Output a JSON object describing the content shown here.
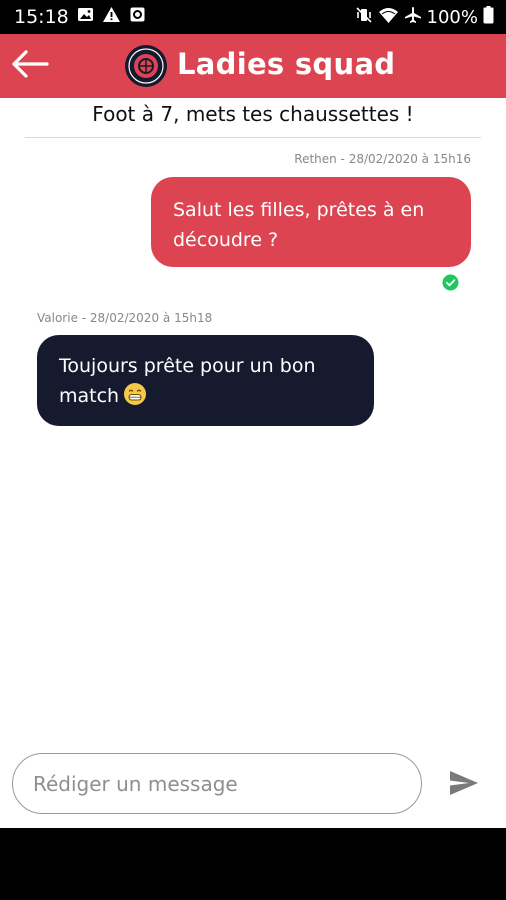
{
  "status_bar": {
    "time": "15:18",
    "battery_percent": "100%",
    "left_icons": [
      "image-icon",
      "warning-icon",
      "app-notification-icon"
    ],
    "right_icons": [
      "vibrate-icon",
      "wifi-icon",
      "airplane-icon",
      "battery-icon"
    ]
  },
  "app_bar": {
    "title": "Ladies squad",
    "back_icon": "arrow-left-icon",
    "logo": "club-logo",
    "background_color": "#dc4451"
  },
  "conversation": {
    "subject": "Foot à 7, mets tes chaussettes !",
    "messages": [
      {
        "direction": "outgoing",
        "author_meta": "Rethen - 28/02/2020 à 15h16",
        "text": "Salut les filles, prêtes à en découdre ?",
        "status": "read",
        "status_icon": "check-circle-icon",
        "bubble_color": "#dc4451"
      },
      {
        "direction": "incoming",
        "author_meta": "Valorie - 28/02/2020 à 15h18",
        "text": "Toujours prête pour un bon match",
        "emoji": "grinning-face-icon",
        "bubble_color": "#151a2e"
      }
    ]
  },
  "composer": {
    "placeholder": "Rédiger un message",
    "value": "",
    "send_icon": "send-icon"
  },
  "colors": {
    "accent": "#dc4451",
    "incoming_bubble": "#151a2e",
    "read_check": "#22c55e"
  }
}
